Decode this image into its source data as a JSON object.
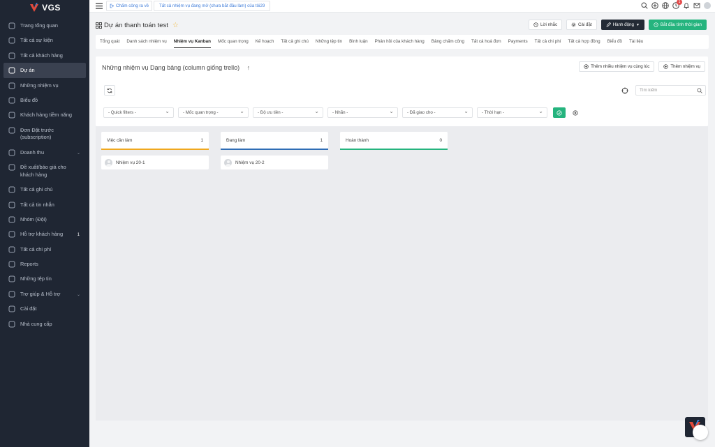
{
  "brand": {
    "name": "VGS"
  },
  "sidebar": {
    "items": [
      {
        "label": "Trang tổng quan",
        "icon": "monitor-icon"
      },
      {
        "label": "Tất cả sự kiện",
        "icon": "calendar-icon"
      },
      {
        "label": "Tất cả khách hàng",
        "icon": "briefcase-icon"
      },
      {
        "label": "Dự án",
        "icon": "command-icon",
        "active": true
      },
      {
        "label": "Những nhiệm vụ",
        "icon": "check-circle-icon"
      },
      {
        "label": "Biểu đồ",
        "icon": "pen-tool-icon"
      },
      {
        "label": "Khách hàng tiềm năng",
        "icon": "layers-icon"
      },
      {
        "label": "Đơn Đặt trước (subscription)",
        "icon": "repeat-icon"
      },
      {
        "label": "Doanh thu",
        "icon": "cart-icon"
      },
      {
        "label": "Đề xuất/báo giá cho khách hàng",
        "icon": "anchor-icon"
      },
      {
        "label": "Tất cả ghi chú",
        "icon": "book-icon"
      },
      {
        "label": "Tất cả tin nhắn",
        "icon": "message-circle-icon"
      },
      {
        "label": "Nhóm (Đội)",
        "icon": "users-icon"
      },
      {
        "label": "Hỗ trợ khách hàng",
        "icon": "life-buoy-icon",
        "badge": "1"
      },
      {
        "label": "Tất cả chi phí",
        "icon": "arrow-circle-icon"
      },
      {
        "label": "Reports",
        "icon": "pie-chart-icon"
      },
      {
        "label": "Những tệp tin",
        "icon": "cloud-icon"
      },
      {
        "label": "Trợ giúp & Hỗ trợ",
        "icon": "help-circle-icon"
      },
      {
        "label": "Cài đặt",
        "icon": "settings-icon"
      },
      {
        "label": "Nhà cung cấp",
        "icon": "user-icon"
      }
    ]
  },
  "topbar": {
    "clock_label": "Chấm công ra về",
    "task_pill": "Tất cả nhiệm vụ đang mở (chưa bắt đầu làm) của tôi29",
    "notification_count": "1"
  },
  "header": {
    "title": "Dự án thanh toán test",
    "reminder": "Lời nhắc",
    "settings": "Cài đặt",
    "actions": "Hành động",
    "start_timer": "Bắt đầu tính thời gian"
  },
  "tabs": [
    "Tổng quát",
    "Danh sách nhiệm vụ",
    "Nhiệm vụ Kanban",
    "Mốc quan trọng",
    "Kế hoạch",
    "Tất cả ghi chú",
    "Những tệp tin",
    "Bình luận",
    "Phản hồi của khách hàng",
    "Bảng chấm công",
    "Tất cả hoá đơn",
    "Payments",
    "Tất cả chi phí",
    "Tất cả hợp đồng",
    "Biểu đồ",
    "Tài liệu"
  ],
  "active_tab": "Nhiệm vụ Kanban",
  "panel": {
    "title": "Những nhiệm vụ Dạng bảng (column giống trello)",
    "add_multiple": "Thêm nhiều nhiệm vụ cùng lúc",
    "add_task": "Thêm nhiệm vụ",
    "search_placeholder": "Tìm kiếm",
    "filters": [
      "- Quick filters -",
      "- Mốc quan trọng -",
      "- Độ ưu tiên -",
      "- Nhãn -",
      "- Đã giao cho -",
      "- Thời hạn -"
    ]
  },
  "board": {
    "columns": [
      {
        "title": "Việc cần làm",
        "count": "1",
        "color": "#f0a81e",
        "cards": [
          "Nhiệm vụ 20-1"
        ]
      },
      {
        "title": "Đang làm",
        "count": "1",
        "color": "#2f6db5",
        "cards": [
          "Nhiệm vụ 20-2"
        ]
      },
      {
        "title": "Hoàn thành",
        "count": "0",
        "color": "#25b47e",
        "cards": []
      }
    ]
  }
}
